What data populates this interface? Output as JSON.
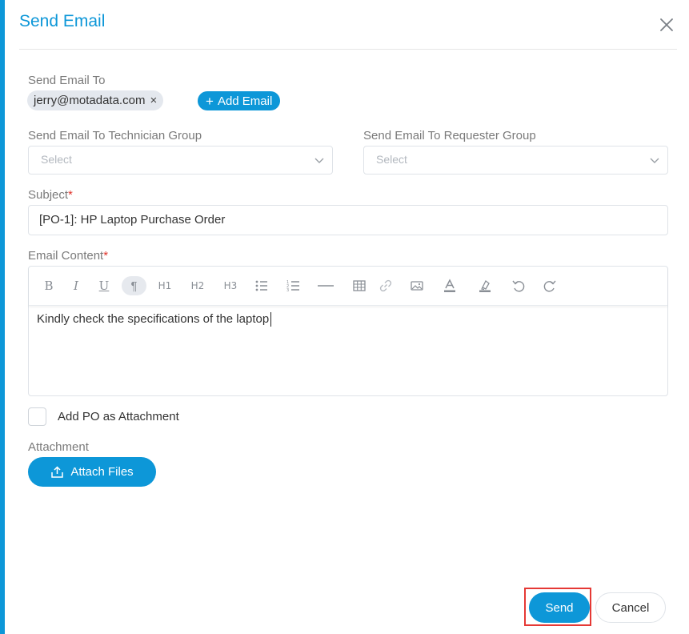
{
  "dialog": {
    "title": "Send Email"
  },
  "recipients": {
    "label": "Send Email To",
    "chips": [
      "jerry@motadata.com"
    ],
    "remove_icon": "×",
    "add_button": "Add Email"
  },
  "technician_group": {
    "label": "Send Email To Technician Group",
    "placeholder": "Select"
  },
  "requester_group": {
    "label": "Send Email To Requester Group",
    "placeholder": "Select"
  },
  "subject": {
    "label": "Subject",
    "required_mark": "*",
    "value": "[PO-1]: HP Laptop Purchase Order"
  },
  "email_content": {
    "label": "Email Content",
    "required_mark": "*",
    "body": "Kindly check the specifications of the laptop",
    "toolbar": {
      "bold": "B",
      "italic": "I",
      "underline": "U",
      "paragraph": "¶",
      "h1": "H1",
      "h2": "H2",
      "h3": "H3",
      "icons": [
        "bold-icon",
        "italic-icon",
        "underline-icon",
        "paragraph-icon",
        "h1-icon",
        "h2-icon",
        "h3-icon",
        "bullet-list-icon",
        "numbered-list-icon",
        "horizontal-rule-icon",
        "table-icon",
        "link-icon",
        "image-icon",
        "text-color-icon",
        "highlight-icon",
        "undo-icon",
        "redo-icon"
      ]
    }
  },
  "po_attachment": {
    "label": "Add PO as Attachment",
    "checked": false
  },
  "attachment": {
    "label": "Attachment",
    "button": "Attach Files"
  },
  "footer": {
    "send": "Send",
    "cancel": "Cancel"
  },
  "colors": {
    "accent": "#0d97d8",
    "required": "#e0342b",
    "highlight_border": "#e53935"
  }
}
